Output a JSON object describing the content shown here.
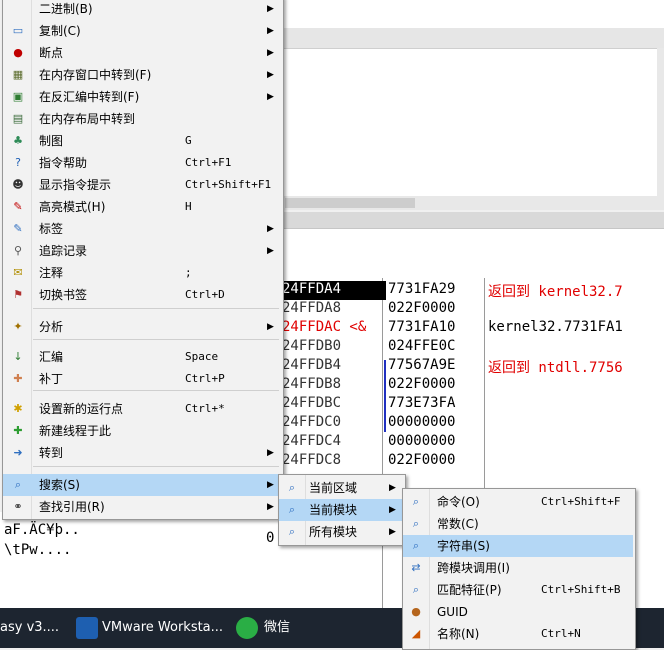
{
  "main_menu": {
    "items": [
      {
        "label": "二进制(B)",
        "shortcut": "",
        "submenu": true,
        "icon": "binary-icon"
      },
      {
        "label": "复制(C)",
        "shortcut": "",
        "submenu": true,
        "icon": "copy-icon"
      },
      {
        "label": "断点",
        "shortcut": "",
        "submenu": true,
        "icon": "breakpoint-icon"
      },
      {
        "label": "在内存窗口中转到(F)",
        "shortcut": "",
        "submenu": true,
        "icon": "memory-icon"
      },
      {
        "label": "在反汇编中转到(F)",
        "shortcut": "",
        "submenu": true,
        "icon": "cpu-icon"
      },
      {
        "label": "在内存布局中转到",
        "shortcut": "",
        "submenu": false,
        "icon": "memory-map-icon"
      },
      {
        "label": "制图",
        "shortcut": "G",
        "submenu": false,
        "icon": "graph-icon"
      },
      {
        "label": "指令帮助",
        "shortcut": "Ctrl+F1",
        "submenu": false,
        "icon": "help-icon"
      },
      {
        "label": "显示指令提示",
        "shortcut": "Ctrl+Shift+F1",
        "submenu": false,
        "icon": "hint-icon"
      },
      {
        "label": "高亮模式(H)",
        "shortcut": "H",
        "submenu": false,
        "icon": "highlight-icon"
      },
      {
        "label": "标签",
        "shortcut": "",
        "submenu": true,
        "icon": "label-icon"
      },
      {
        "label": "追踪记录",
        "shortcut": "",
        "submenu": true,
        "icon": "trace-icon"
      },
      {
        "label": "注释",
        "shortcut": ";",
        "submenu": false,
        "icon": "comment-icon"
      },
      {
        "label": "切换书签",
        "shortcut": "Ctrl+D",
        "submenu": false,
        "icon": "bookmark-icon"
      },
      {
        "label": "分析",
        "shortcut": "",
        "submenu": true,
        "icon": "analyze-icon"
      },
      {
        "label": "汇编",
        "shortcut": "Space",
        "submenu": false,
        "icon": "assemble-icon"
      },
      {
        "label": "补丁",
        "shortcut": "Ctrl+P",
        "submenu": false,
        "icon": "patch-icon"
      },
      {
        "label": "设置新的运行点",
        "shortcut": "Ctrl+*",
        "submenu": false,
        "icon": "new-origin-icon"
      },
      {
        "label": "新建线程于此",
        "shortcut": "",
        "submenu": false,
        "icon": "new-thread-icon"
      },
      {
        "label": "转到",
        "shortcut": "",
        "submenu": true,
        "icon": "goto-icon"
      },
      {
        "label": "搜索(S)",
        "shortcut": "",
        "submenu": true,
        "icon": "search-icon"
      },
      {
        "label": "查找引用(R)",
        "shortcut": "",
        "submenu": true,
        "icon": "references-icon"
      }
    ]
  },
  "search_submenu": {
    "items": [
      {
        "label": "当前区域",
        "icon": "search-region-icon"
      },
      {
        "label": "当前模块",
        "icon": "search-module-icon"
      },
      {
        "label": "所有模块",
        "icon": "search-all-icon"
      }
    ]
  },
  "module_submenu": {
    "items": [
      {
        "label": "命令(O)",
        "shortcut": "Ctrl+Shift+F",
        "icon": "command-icon"
      },
      {
        "label": "常数(C)",
        "shortcut": "",
        "icon": "constant-icon"
      },
      {
        "label": "字符串(S)",
        "shortcut": "",
        "icon": "string-icon"
      },
      {
        "label": "跨模块调用(I)",
        "shortcut": "",
        "icon": "intermodular-icon"
      },
      {
        "label": "匹配特征(P)",
        "shortcut": "Ctrl+Shift+B",
        "icon": "pattern-icon"
      },
      {
        "label": "GUID",
        "shortcut": "",
        "icon": "guid-icon"
      },
      {
        "label": "名称(N)",
        "shortcut": "Ctrl+N",
        "icon": "names-icon"
      }
    ]
  },
  "stack": {
    "rows": [
      {
        "addr": "24FFDA4",
        "value": "7731FA29",
        "comment": "返回到 kernel32.7",
        "style": "sel"
      },
      {
        "addr": "24FFDA8",
        "value": "022F0000",
        "comment": "",
        "style": ""
      },
      {
        "addr": "24FFDAC <&",
        "value": "7731FA10",
        "comment": "kernel32.7731FA1",
        "style": "red"
      },
      {
        "addr": "24FFDB0",
        "value": "024FFE0C",
        "comment": "",
        "style": ""
      },
      {
        "addr": "24FFDB4",
        "value": "77567A9E",
        "comment": "返回到 ntdll.7756",
        "style": ""
      },
      {
        "addr": "24FFDB8",
        "value": "022F0000",
        "comment": "",
        "style": ""
      },
      {
        "addr": "24FFDBC",
        "value": "773E73FA",
        "comment": "",
        "style": ""
      },
      {
        "addr": "24FFDC0",
        "value": "00000000",
        "comment": "",
        "style": ""
      },
      {
        "addr": "24FFDC4",
        "value": "00000000",
        "comment": "",
        "style": ""
      },
      {
        "addr": "24FFDC8",
        "value": "022F0000",
        "comment": "",
        "style": ""
      }
    ]
  },
  "dump": {
    "lines": [
      "aF.ÄC¥þ..",
      "\\tPw...."
    ],
    "extra": "0"
  },
  "taskbar": {
    "items": [
      {
        "label": "asy v3....",
        "icon": "app-icon"
      },
      {
        "label": "VMware Worksta...",
        "icon": "vmware-icon"
      },
      {
        "label": "微信",
        "icon": "wechat-icon"
      }
    ]
  },
  "colors": {
    "menu_highlight": "#b4d7f5",
    "red_text": "#e00000",
    "taskbar": "#1d2530"
  }
}
